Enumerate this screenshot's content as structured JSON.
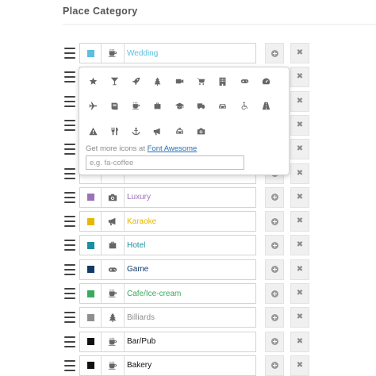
{
  "title": "Place Category",
  "rows": [
    {
      "name": "Wedding",
      "color": "#5bc0de",
      "icon": "coffee-icon"
    },
    {
      "name": "",
      "color": "",
      "icon": ""
    },
    {
      "name": "",
      "color": "",
      "icon": ""
    },
    {
      "name": "",
      "color": "",
      "icon": ""
    },
    {
      "name": "",
      "color": "",
      "icon": ""
    },
    {
      "name": "",
      "color": "",
      "icon": ""
    },
    {
      "name": "Luxury",
      "color": "#9b72b5",
      "icon": "camera-icon"
    },
    {
      "name": "Karaoke",
      "color": "#e6b800",
      "icon": "bullhorn-icon"
    },
    {
      "name": "Hotel",
      "color": "#1a8fa0",
      "icon": "suitcase-icon"
    },
    {
      "name": "Game",
      "color": "#123a66",
      "icon": "gamepad-icon"
    },
    {
      "name": "Cafe/Ice-cream",
      "color": "#3aaa5c",
      "icon": "coffee-icon"
    },
    {
      "name": "Billiards",
      "color": "#8f8f8f",
      "icon": "tree-icon"
    },
    {
      "name": "Bar/Pub",
      "color": "#111111",
      "icon": "coffee-icon"
    },
    {
      "name": "Bakery",
      "color": "#111111",
      "icon": "coffee-icon"
    }
  ],
  "popup": {
    "icons": [
      [
        "star-icon",
        "glass-icon",
        "rocket-icon",
        "tree-icon",
        "video-icon",
        "cart-icon",
        "building-icon",
        "gamepad-icon",
        "dashboard-icon"
      ],
      [
        "plane-icon",
        "book-icon",
        "coffee-icon",
        "suitcase-icon",
        "graduation-cap-icon",
        "truck-icon",
        "car-icon",
        "wheelchair-icon",
        "road-icon"
      ],
      [
        "warning-icon",
        "cutlery-icon",
        "anchor-icon",
        "bullhorn-icon",
        "cab-icon",
        "camera-icon"
      ]
    ],
    "hint_prefix": "Get more icons at ",
    "hint_link": "Font Awesome",
    "search_placeholder": "e.g. fa-coffee"
  }
}
